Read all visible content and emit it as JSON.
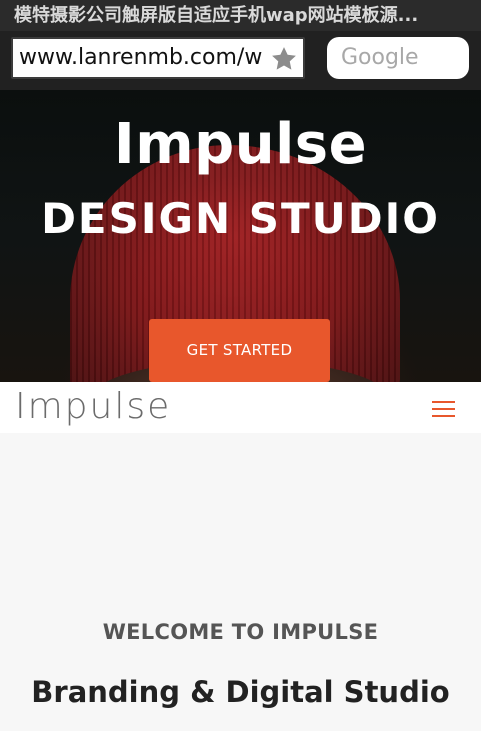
{
  "browser": {
    "page_title": "模特摄影公司触屏版自适应手机wap网站模板源...",
    "url": "www.lanrenmb.com/w",
    "search_placeholder": "Google",
    "bookmark_icon": "star-icon"
  },
  "hero": {
    "title": "Impulse",
    "subtitle": "DESIGN STUDIO",
    "cta_label": "GET STARTED",
    "accent_color": "#e8572c"
  },
  "nav": {
    "logo": "Impulse",
    "menu_icon": "hamburger-menu-icon"
  },
  "content": {
    "welcome": "WELCOME TO IMPULSE",
    "tagline": "Branding & Digital Studio"
  }
}
